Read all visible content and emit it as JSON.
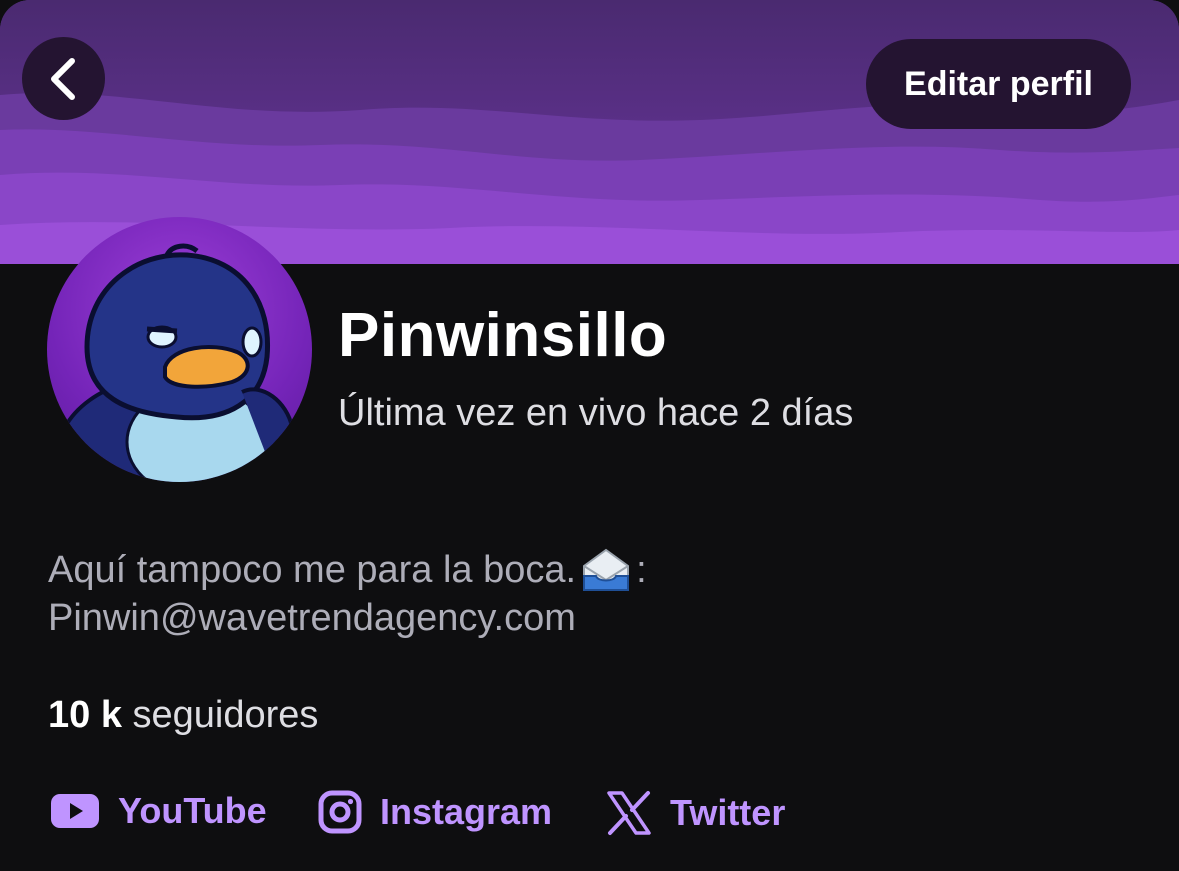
{
  "header": {
    "back_icon": "chevron-left-icon",
    "edit_label": "Editar perfil"
  },
  "profile": {
    "channel_name": "Pinwinsillo",
    "last_live": "Última vez en vivo hace 2 días",
    "bio_line1": "Aquí tampoco me para la boca.",
    "bio_line1_suffix": ":",
    "bio_icon": "incoming-envelope-icon",
    "bio_line2": "Pinwin@wavetrendagency.com",
    "followers_count": "10 k",
    "followers_label": "seguidores"
  },
  "socials": [
    {
      "label": "YouTube",
      "icon": "youtube-icon"
    },
    {
      "label": "Instagram",
      "icon": "instagram-icon"
    },
    {
      "label": "Twitter",
      "icon": "x-twitter-icon"
    }
  ],
  "colors": {
    "accent": "#bf94ff",
    "background": "#0e0e10",
    "banner": "#7d3cc0",
    "button": "#241431"
  }
}
